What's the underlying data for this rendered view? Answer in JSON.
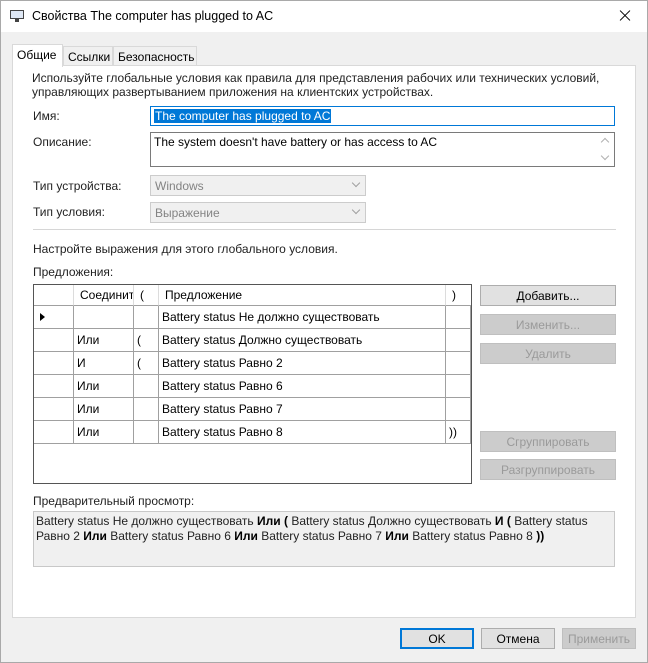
{
  "window": {
    "title": "Свойства The computer has plugged to AC"
  },
  "tabs": [
    {
      "label": "Общие",
      "active": true
    },
    {
      "label": "Ссылки",
      "active": false
    },
    {
      "label": "Безопасность",
      "active": false
    }
  ],
  "general": {
    "intro_line1": "Используйте глобальные условия как правила для представления рабочих или технических условий,",
    "intro_line2": "управляющих развертыванием приложения на клиентских устройствах.",
    "name_label": "Имя:",
    "name_value": "The computer has plugged to AC",
    "description_label": "Описание:",
    "description_value": "The system doesn't have battery or has access to AC",
    "device_type_label": "Тип устройства:",
    "device_type_value": "Windows",
    "condition_type_label": "Тип условия:",
    "condition_type_value": "Выражение",
    "configure_text": "Настройте выражения для этого глобального условия.",
    "clauses_label": "Предложения:"
  },
  "grid": {
    "columns": [
      "",
      "Соедините",
      "(",
      "Предложение",
      ")"
    ],
    "rows": [
      {
        "connector": "",
        "open": "",
        "clause": "Battery status Не должно существовать",
        "close": "",
        "current": true
      },
      {
        "connector": "Или",
        "open": "(",
        "clause": "Battery status Должно существовать",
        "close": ""
      },
      {
        "connector": "И",
        "open": "(",
        "clause": "Battery status Равно 2",
        "close": ""
      },
      {
        "connector": "Или",
        "open": "",
        "clause": "Battery status Равно 6",
        "close": ""
      },
      {
        "connector": "Или",
        "open": "",
        "clause": "Battery status Равно 7",
        "close": ""
      },
      {
        "connector": "Или",
        "open": "",
        "clause": "Battery status Равно 8",
        "close": "))"
      }
    ]
  },
  "side_buttons": {
    "add": "Добавить...",
    "edit": "Изменить...",
    "delete": "Удалить",
    "group": "Сгруппировать",
    "ungroup": "Разгруппировать"
  },
  "preview": {
    "label": "Предварительный просмотр:",
    "parts": [
      {
        "text": "Battery status Не должно существовать ",
        "bold": false
      },
      {
        "text": "Или (",
        "bold": true
      },
      {
        "text": " Battery status Должно существовать ",
        "bold": false
      },
      {
        "text": "И (",
        "bold": true
      },
      {
        "text": " Battery status Равно 2 ",
        "bold": false
      },
      {
        "text": "Или",
        "bold": true
      },
      {
        "text": " Battery status Равно 6 ",
        "bold": false
      },
      {
        "text": "Или",
        "bold": true
      },
      {
        "text": " Battery status Равно 7 ",
        "bold": false
      },
      {
        "text": "Или",
        "bold": true
      },
      {
        "text": " Battery status Равно 8 ",
        "bold": false
      },
      {
        "text": "))",
        "bold": true
      }
    ]
  },
  "footer": {
    "ok": "OK",
    "cancel": "Отмена",
    "apply": "Применить"
  },
  "colors": {
    "selection": "#0078d7",
    "default_button_border": "#0078d7"
  },
  "icons": {
    "window": "computer-icon",
    "close": "close-icon",
    "row_pointer": "row-pointer-icon"
  }
}
